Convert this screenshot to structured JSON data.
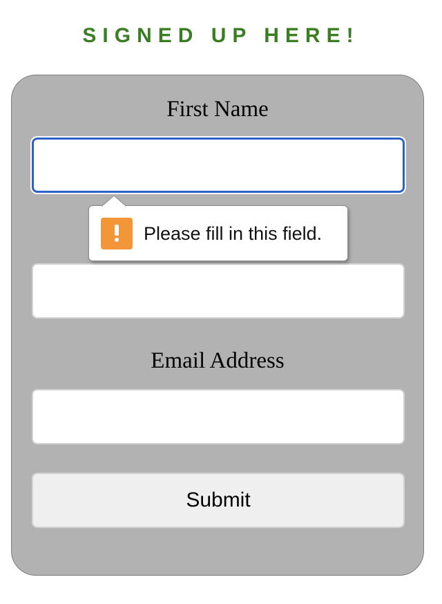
{
  "heading": "SIGNED UP HERE!",
  "form": {
    "first_name_label": "First Name",
    "first_name_value": "",
    "last_name_value": "",
    "email_label": "Email Address",
    "email_value": "",
    "submit_label": "Submit"
  },
  "validation_tooltip": {
    "message": "Please fill in this field.",
    "icon": "warning-exclamation-icon"
  },
  "colors": {
    "heading": "#3a7d22",
    "card_background": "#b2b2b2",
    "focus_ring": "#2f62c8",
    "warning_icon": "#f39638",
    "submit_background": "#efefef"
  }
}
